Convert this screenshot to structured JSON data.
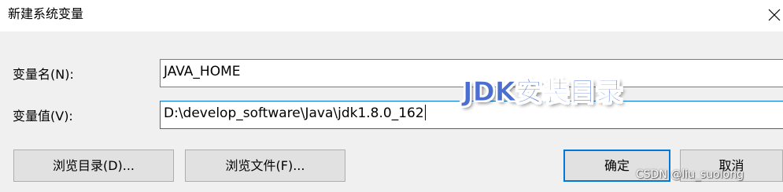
{
  "dialog": {
    "title": "新建系统变量"
  },
  "form": {
    "name_label": "变量名(N):",
    "name_value": "JAVA_HOME",
    "value_label": "变量值(V):",
    "value_value": "D:\\develop_software\\Java\\jdk1.8.0_162"
  },
  "buttons": {
    "browse_directory": "浏览目录(D)...",
    "browse_file": "浏览文件(F)...",
    "ok": "确定",
    "cancel": "取消"
  },
  "annotation": {
    "text": "JDK安装目录",
    "color": "#4b6fd1"
  },
  "watermark": {
    "text": "CSDN @liu_suolong"
  },
  "colors": {
    "focus_border": "#0078d7",
    "dialog_background": "#f0f0f0"
  },
  "icons": {
    "close": "close-icon"
  }
}
